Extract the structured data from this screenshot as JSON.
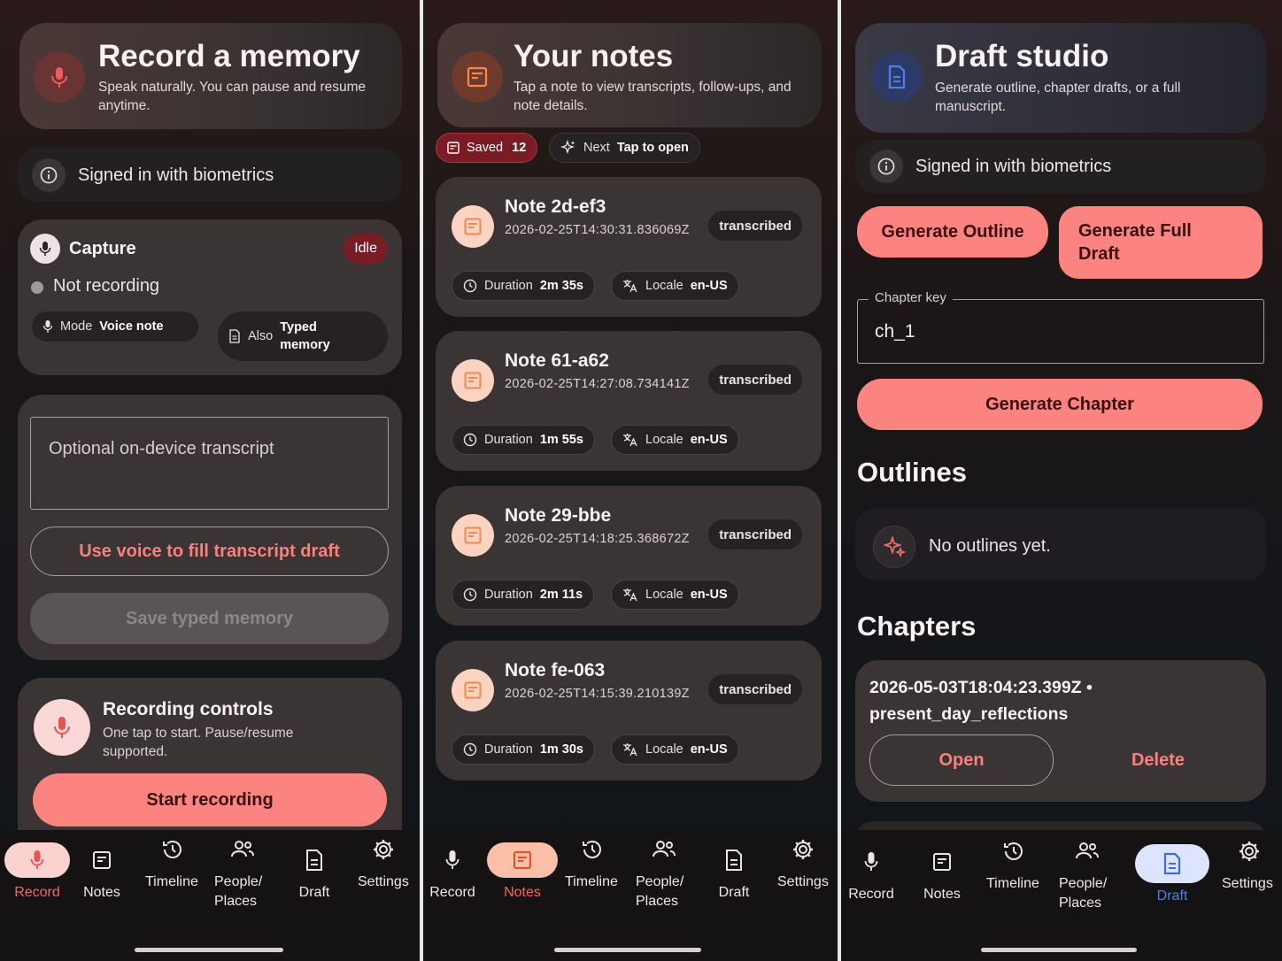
{
  "record": {
    "header": {
      "title": "Record a memory",
      "subtitle": "Speak naturally. You can pause and resume anytime."
    },
    "signed_in": "Signed in with biometrics",
    "capture": {
      "title": "Capture",
      "status_badge": "Idle",
      "state": "Not recording",
      "mode_label": "Mode",
      "mode_value": "Voice note",
      "also_label": "Also",
      "also_value": "Typed memory"
    },
    "transcript_placeholder": "Optional on-device transcript",
    "voice_fill_button": "Use voice to fill transcript draft",
    "save_typed_button": "Save typed memory",
    "controls": {
      "title": "Recording controls",
      "subtitle": "One tap to start. Pause/resume supported.",
      "start_button": "Start recording"
    }
  },
  "notes": {
    "header": {
      "title": "Your notes",
      "subtitle": "Tap a note to view transcripts, follow-ups, and note details."
    },
    "saved_label": "Saved",
    "saved_count": "12",
    "next_label": "Next",
    "next_value": "Tap to open",
    "items": [
      {
        "title": "Note 2d-ef3",
        "timestamp": "2026-02-25T14:30:31.836069Z",
        "status": "transcribed",
        "duration_label": "Duration",
        "duration": "2m 35s",
        "locale_label": "Locale",
        "locale": "en-US"
      },
      {
        "title": "Note 61-a62",
        "timestamp": "2026-02-25T14:27:08.734141Z",
        "status": "transcribed",
        "duration_label": "Duration",
        "duration": "1m 55s",
        "locale_label": "Locale",
        "locale": "en-US"
      },
      {
        "title": "Note 29-bbe",
        "timestamp": "2026-02-25T14:18:25.368672Z",
        "status": "transcribed",
        "duration_label": "Duration",
        "duration": "2m 11s",
        "locale_label": "Locale",
        "locale": "en-US"
      },
      {
        "title": "Note fe-063",
        "timestamp": "2026-02-25T14:15:39.210139Z",
        "status": "transcribed",
        "duration_label": "Duration",
        "duration": "1m 30s",
        "locale_label": "Locale",
        "locale": "en-US"
      }
    ]
  },
  "draft": {
    "header": {
      "title": "Draft studio",
      "subtitle": "Generate outline, chapter drafts, or a full manuscript."
    },
    "signed_in": "Signed in with biometrics",
    "generate_outline": "Generate Outline",
    "generate_full_draft": "Generate Full Draft",
    "chapter_key_label": "Chapter key",
    "chapter_key_value": "ch_1",
    "generate_chapter": "Generate Chapter",
    "outlines_heading": "Outlines",
    "outlines_empty": "No outlines yet.",
    "chapters_heading": "Chapters",
    "chapter_item": {
      "title": "2026-05-03T18:04:23.399Z • present_day_reflections",
      "open": "Open",
      "delete": "Delete"
    }
  },
  "nav": {
    "record": "Record",
    "notes": "Notes",
    "timeline": "Timeline",
    "people_places": "People/ Places",
    "draft": "Draft",
    "settings": "Settings"
  },
  "colors": {
    "accent": "#fb8480",
    "record_active": "#fcd2d0",
    "notes_active": "#fcbfa8",
    "draft_active": "#dce4ff",
    "draft_icon": "#3b6fe0"
  }
}
